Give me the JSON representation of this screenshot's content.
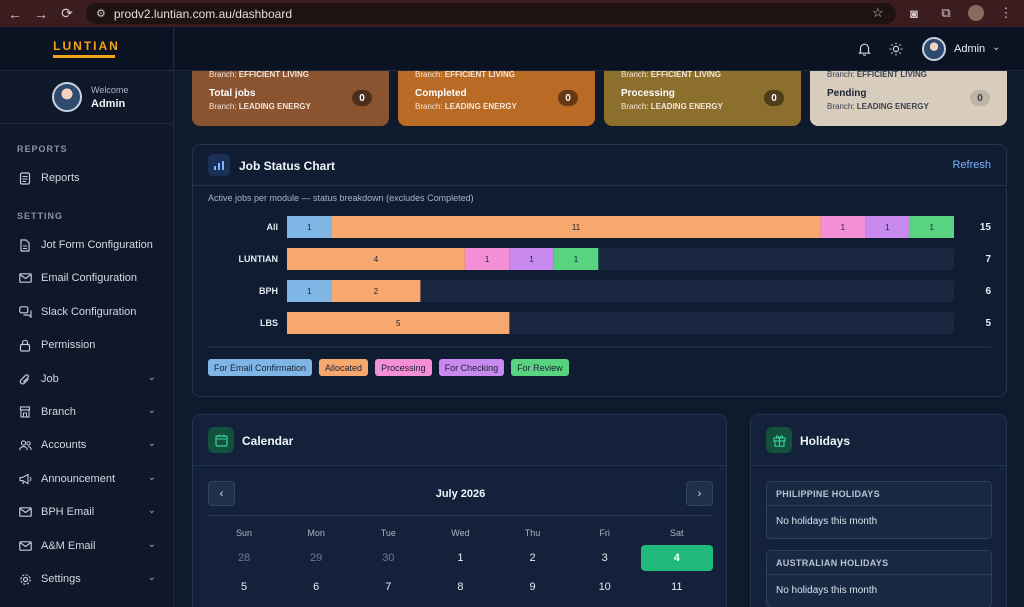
{
  "browser": {
    "url": "prodv2.luntian.com.au/dashboard"
  },
  "sidebar": {
    "logo_text": "LUNTIAN",
    "welcome_label": "Welcome",
    "user_name": "Admin",
    "sections": {
      "reports": "REPORTS",
      "setting": "SETTING"
    },
    "items": [
      {
        "label": "Reports",
        "icon": "document-icon"
      },
      {
        "label": "Jot Form Configuration",
        "icon": "form-icon"
      },
      {
        "label": "Email Configuration",
        "icon": "mail-icon"
      },
      {
        "label": "Slack Configuration",
        "icon": "chat-icon"
      },
      {
        "label": "Permission",
        "icon": "lock-icon"
      },
      {
        "label": "Job",
        "icon": "paperclip-icon"
      },
      {
        "label": "Branch",
        "icon": "store-icon"
      },
      {
        "label": "Accounts",
        "icon": "users-icon"
      },
      {
        "label": "Announcement",
        "icon": "megaphone-icon"
      },
      {
        "label": "BPH Email",
        "icon": "mail-icon"
      },
      {
        "label": "A&M Email",
        "icon": "mail-icon"
      },
      {
        "label": "Settings",
        "icon": "gear-icon"
      }
    ]
  },
  "topbar": {
    "user_name": "Admin"
  },
  "summary_cards": [
    {
      "top_branch_prefix": "Branch: ",
      "top_branch": "EFFICIENT LIVING",
      "title": "Total jobs",
      "branch_prefix": "Branch: ",
      "branch": "LEADING ENERGY",
      "count": "0",
      "color": "#8a5431"
    },
    {
      "top_branch_prefix": "Branch: ",
      "top_branch": "EFFICIENT LIVING",
      "title": "Completed",
      "branch_prefix": "Branch: ",
      "branch": "LEADING ENERGY",
      "count": "0",
      "color": "#b96a24"
    },
    {
      "top_branch_prefix": "Branch: ",
      "top_branch": "EFFICIENT LIVING",
      "title": "Processing",
      "branch_prefix": "Branch: ",
      "branch": "LEADING ENERGY",
      "count": "0",
      "color": "#8c6f2c"
    },
    {
      "top_branch_prefix": "Branch: ",
      "top_branch": "EFFICIENT LIVING",
      "title": "Pending",
      "branch_prefix": "Branch: ",
      "branch": "LEADING ENERGY",
      "count": "0",
      "color": "#d8cdbd"
    }
  ],
  "job_chart": {
    "title": "Job Status Chart",
    "refresh_label": "Refresh",
    "subtitle": "Active jobs per module — status breakdown (excludes Completed)"
  },
  "chart_data": {
    "type": "bar",
    "orientation": "horizontal",
    "stacked": true,
    "categories": [
      "All",
      "LUNTIAN",
      "BPH",
      "LBS"
    ],
    "totals": [
      15,
      7,
      6,
      5
    ],
    "xlim": [
      0,
      15
    ],
    "series": [
      {
        "name": "For Email Confirmation",
        "color": "#7fb6e6",
        "values": [
          1,
          0,
          1,
          0
        ]
      },
      {
        "name": "Allocated",
        "color": "#f7a86f",
        "values": [
          11,
          4,
          2,
          5
        ]
      },
      {
        "name": "Processing",
        "color": "#f48fd6",
        "values": [
          1,
          1,
          0,
          0
        ]
      },
      {
        "name": "For Checking",
        "color": "#c98af0",
        "values": [
          1,
          1,
          0,
          0
        ]
      },
      {
        "name": "For Review",
        "color": "#58d37f",
        "values": [
          1,
          1,
          0,
          0
        ]
      }
    ]
  },
  "calendar": {
    "title": "Calendar",
    "month_label": "July 2026",
    "prev_label": "‹",
    "next_label": "›",
    "weekdays": [
      "Sun",
      "Mon",
      "Tue",
      "Wed",
      "Thu",
      "Fri",
      "Sat"
    ],
    "rows": [
      [
        "28",
        "29",
        "30",
        "1",
        "2",
        "3",
        "4"
      ],
      [
        "5",
        "6",
        "7",
        "8",
        "9",
        "10",
        "11"
      ]
    ],
    "muted_count_first_row": 3,
    "today": "4"
  },
  "holidays": {
    "title": "Holidays",
    "sections": [
      {
        "heading": "PHILIPPINE HOLIDAYS",
        "text": "No holidays this month"
      },
      {
        "heading": "AUSTRALIAN HOLIDAYS",
        "text": "No holidays this month"
      }
    ]
  }
}
